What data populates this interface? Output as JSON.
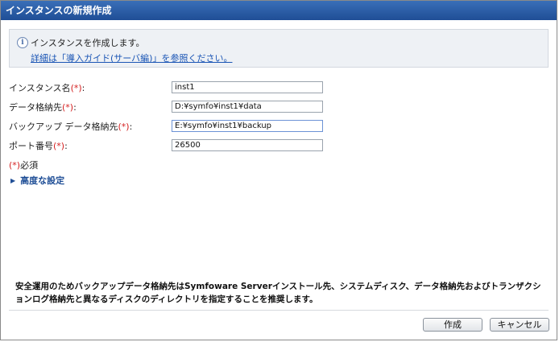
{
  "window": {
    "title": "インスタンスの新規作成"
  },
  "info": {
    "icon": "info-icon",
    "message": "インスタンスを作成します。",
    "link": "詳細は「導入ガイド(サーバ編)」を参照ください。"
  },
  "form": {
    "required_mark": "(*)",
    "instance_name": {
      "label": "インスタンス名",
      "suffix": ":",
      "value": "inst1"
    },
    "data_dir": {
      "label": "データ格納先",
      "suffix": ":",
      "value": "D:¥symfo¥inst1¥data"
    },
    "backup_dir": {
      "label": "バックアップ データ格納先",
      "suffix": ":",
      "value": "E:¥symfo¥inst1¥backup"
    },
    "port": {
      "label": "ポート番号",
      "suffix": ":",
      "value": "26500"
    },
    "required_note": "必須",
    "advanced_label": "高度な設定"
  },
  "notice": "安全運用のためバックアップデータ格納先はSymfoware Serverインストール先、システムディスク、データ格納先およびトランザクションログ格納先と異なるディスクのディレクトリを指定することを推奨します。",
  "buttons": {
    "create": "作成",
    "cancel": "キャンセル"
  },
  "colors": {
    "title_bar": "#1f4e96",
    "required": "#d42020",
    "link": "#1a55b5"
  }
}
